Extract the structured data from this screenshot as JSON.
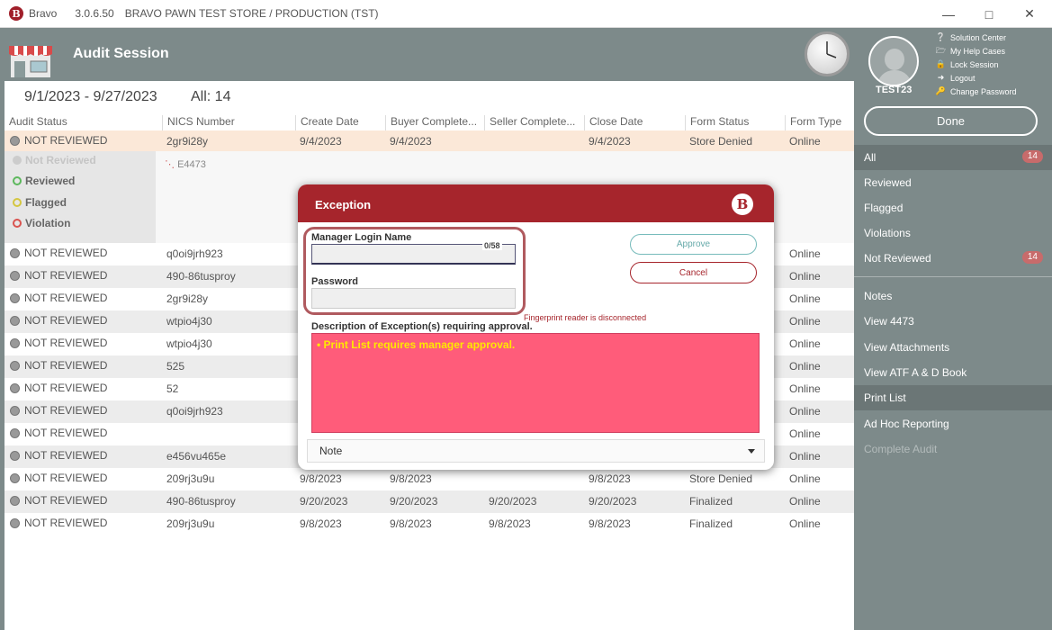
{
  "titlebar": {
    "app": "Bravo",
    "version": "3.0.6.50",
    "store": "BRAVO PAWN TEST STORE / PRODUCTION (TST)",
    "logo": "B"
  },
  "header": {
    "title": "Audit Session"
  },
  "main": {
    "date_range": "9/1/2023 - 9/27/2023",
    "all_count": "All: 14",
    "columns": [
      "Audit Status",
      "NICS Number",
      "Create Date",
      "Buyer Complete...",
      "Seller Complete...",
      "Close Date",
      "Form Status",
      "Form Type"
    ],
    "rows": [
      {
        "status": "NOT REVIEWED",
        "nics": "2gr9i28y",
        "create": "9/4/2023",
        "buyer": "9/4/2023",
        "seller": "",
        "close": "9/4/2023",
        "form_status": "Store Denied",
        "form_type": "Online"
      },
      {
        "status": "NOT REVIEWED",
        "nics": "q0oi9jrh923",
        "create": "",
        "buyer": "",
        "seller": "",
        "close": "",
        "form_status": "",
        "form_type": "Online"
      },
      {
        "status": "NOT REVIEWED",
        "nics": "490-86tusproy",
        "create": "",
        "buyer": "",
        "seller": "",
        "close": "",
        "form_status": "",
        "form_type": "Online"
      },
      {
        "status": "NOT REVIEWED",
        "nics": "2gr9i28y",
        "create": "",
        "buyer": "",
        "seller": "",
        "close": "",
        "form_status": "",
        "form_type": "Online"
      },
      {
        "status": "NOT REVIEWED",
        "nics": "wtpio4j30",
        "create": "",
        "buyer": "",
        "seller": "",
        "close": "",
        "form_status": "",
        "form_type": "Online"
      },
      {
        "status": "NOT REVIEWED",
        "nics": "wtpio4j30",
        "create": "",
        "buyer": "",
        "seller": "",
        "close": "",
        "form_status": "",
        "form_type": "Online"
      },
      {
        "status": "NOT REVIEWED",
        "nics": "525",
        "create": "",
        "buyer": "",
        "seller": "",
        "close": "",
        "form_status": "",
        "form_type": "Online"
      },
      {
        "status": "NOT REVIEWED",
        "nics": "52",
        "create": "",
        "buyer": "",
        "seller": "",
        "close": "",
        "form_status": "",
        "form_type": "Online"
      },
      {
        "status": "NOT REVIEWED",
        "nics": "q0oi9jrh923",
        "create": "",
        "buyer": "",
        "seller": "",
        "close": "",
        "form_status": "",
        "form_type": "Online"
      },
      {
        "status": "NOT REVIEWED",
        "nics": "",
        "create": "",
        "buyer": "",
        "seller": "",
        "close": "",
        "form_status": "",
        "form_type": "Online"
      },
      {
        "status": "NOT REVIEWED",
        "nics": "e456vu465e",
        "create": "",
        "buyer": "",
        "seller": "",
        "close": "",
        "form_status": "",
        "form_type": "Online"
      },
      {
        "status": "NOT REVIEWED",
        "nics": "209rj3u9u",
        "create": "9/8/2023",
        "buyer": "9/8/2023",
        "seller": "",
        "close": "9/8/2023",
        "form_status": "Store Denied",
        "form_type": "Online"
      },
      {
        "status": "NOT REVIEWED",
        "nics": "490-86tusproy",
        "create": "9/20/2023",
        "buyer": "9/20/2023",
        "seller": "9/20/2023",
        "close": "9/20/2023",
        "form_status": "Finalized",
        "form_type": "Online"
      },
      {
        "status": "NOT REVIEWED",
        "nics": "209rj3u9u",
        "create": "9/8/2023",
        "buyer": "9/8/2023",
        "seller": "9/8/2023",
        "close": "9/8/2023",
        "form_status": "Finalized",
        "form_type": "Online"
      }
    ],
    "expand": {
      "options": [
        {
          "label": "Not Reviewed",
          "color": "#cccccc"
        },
        {
          "label": "Reviewed",
          "color": "#5cb85c"
        },
        {
          "label": "Flagged",
          "color": "#d4c640"
        },
        {
          "label": "Violation",
          "color": "#d9534f"
        }
      ],
      "file": "E4473"
    }
  },
  "user": {
    "name": "TEST23",
    "links": [
      {
        "label": "Solution Center",
        "icon": "help-icon"
      },
      {
        "label": "My Help Cases",
        "icon": "folder-icon"
      },
      {
        "label": "Lock Session",
        "icon": "lock-icon"
      },
      {
        "label": "Logout",
        "icon": "logout-icon"
      },
      {
        "label": "Change Password",
        "icon": "key-icon"
      }
    ]
  },
  "sidebar": {
    "done_label": "Done",
    "filters": [
      {
        "label": "All",
        "badge": "14"
      },
      {
        "label": "Reviewed",
        "badge": ""
      },
      {
        "label": "Flagged",
        "badge": ""
      },
      {
        "label": "Violations",
        "badge": ""
      },
      {
        "label": "Not Reviewed",
        "badge": "14"
      }
    ],
    "actions": [
      {
        "label": "Notes"
      },
      {
        "label": "View 4473"
      },
      {
        "label": "View Attachments"
      },
      {
        "label": "View ATF A & D Book"
      },
      {
        "label": "Print List"
      },
      {
        "label": "Ad Hoc Reporting"
      },
      {
        "label": "Complete Audit"
      }
    ]
  },
  "modal": {
    "title": "Exception",
    "logo": "B",
    "login_label": "Manager Login Name",
    "login_value": "",
    "login_counter": "0/58",
    "password_label": "Password",
    "password_value": "",
    "approve_label": "Approve",
    "cancel_label": "Cancel",
    "fingerprint_msg": "Fingerprint reader is disconnected",
    "desc_label": "Description of Exception(s) requiring approval.",
    "desc_text": "• Print List requires manager approval.",
    "note_value": "Note",
    "colors": {
      "header": "#a6252c",
      "desc_bg": "#ff5c7a",
      "desc_text": "#ffe800"
    }
  }
}
